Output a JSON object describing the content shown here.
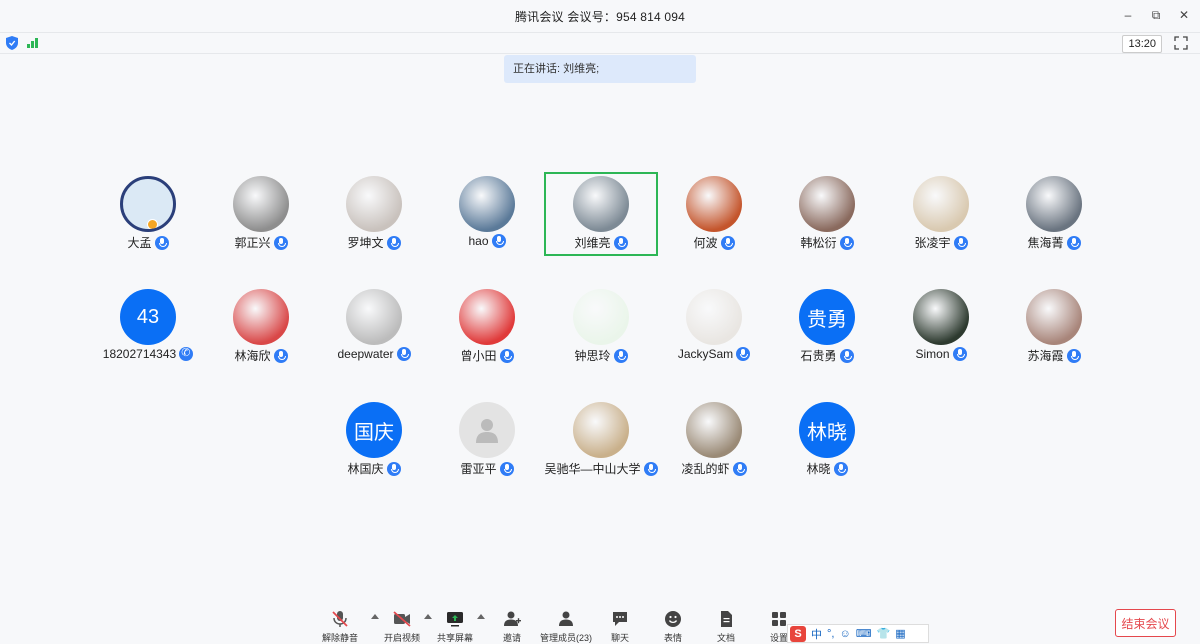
{
  "window": {
    "title": "腾讯会议 会议号：954 814 094",
    "clock": "13:20"
  },
  "speaking": "正在讲话: 刘维亮;",
  "participants": [
    {
      "name": "大孟",
      "type": "photo",
      "color": "#2b3f7a",
      "badge": "mic",
      "host": true
    },
    {
      "name": "郭正兴",
      "type": "photo",
      "color": "#8e8e8e",
      "badge": "mic"
    },
    {
      "name": "罗坤文",
      "type": "photo",
      "color": "#c9c2bd",
      "badge": "mic"
    },
    {
      "name": "hao",
      "type": "photo",
      "color": "#5b7a99",
      "badge": "mic"
    },
    {
      "name": "刘维亮",
      "type": "photo",
      "color": "#7d8a95",
      "badge": "mic",
      "active": true
    },
    {
      "name": "何波",
      "type": "photo",
      "color": "#c4552c",
      "badge": "mic"
    },
    {
      "name": "韩松衍",
      "type": "photo",
      "color": "#8a6a5e",
      "badge": "mic"
    },
    {
      "name": "张凌宇",
      "type": "photo",
      "color": "#d9c9b0",
      "badge": "mic"
    },
    {
      "name": "焦海菁",
      "type": "photo",
      "color": "#6a7480",
      "badge": "mic"
    },
    {
      "name": "18202714343",
      "type": "initials",
      "initials": "43",
      "badge": "phone"
    },
    {
      "name": "林海欣",
      "type": "photo",
      "color": "#d94848",
      "badge": "mic"
    },
    {
      "name": "deepwater",
      "type": "photo",
      "color": "#bcbcbc",
      "badge": "mic"
    },
    {
      "name": "曾小田",
      "type": "photo",
      "color": "#e03a3a",
      "badge": "mic"
    },
    {
      "name": "钟思玲",
      "type": "photo",
      "color": "#eaf5ea",
      "badge": "mic"
    },
    {
      "name": "JackySam",
      "type": "photo",
      "color": "#e9e6e2",
      "badge": "mic"
    },
    {
      "name": "石贵勇",
      "type": "initials",
      "initials": "贵勇",
      "badge": "mic"
    },
    {
      "name": "Simon",
      "type": "photo",
      "color": "#2d3a2f",
      "badge": "mic"
    },
    {
      "name": "苏海霞",
      "type": "photo",
      "color": "#a8857a",
      "badge": "mic"
    },
    {
      "name": "林国庆",
      "type": "initials",
      "initials": "国庆",
      "badge": "mic"
    },
    {
      "name": "雷亚平",
      "type": "default",
      "color": "#e3e3e3",
      "badge": "mic"
    },
    {
      "name": "吴驰华—中山大学",
      "type": "photo",
      "color": "#c9b08b",
      "badge": "mic"
    },
    {
      "name": "凌乱的虾",
      "type": "photo",
      "color": "#9a8a76",
      "badge": "mic"
    },
    {
      "name": "林晓",
      "type": "initials",
      "initials": "林晓",
      "badge": "mic"
    }
  ],
  "toolbar": {
    "unmute": "解除静音",
    "video": "开启视频",
    "share": "共享屏幕",
    "invite": "邀请",
    "members": "管理成员(23)",
    "chat": "聊天",
    "reactions": "表情",
    "docs": "文档",
    "settings": "设置",
    "end": "结束会议"
  },
  "ime": {
    "logo": "S",
    "mode": "中"
  },
  "colors": {
    "accent": "#0a6ff5",
    "active_border": "#2db655",
    "end": "#e5484d"
  }
}
